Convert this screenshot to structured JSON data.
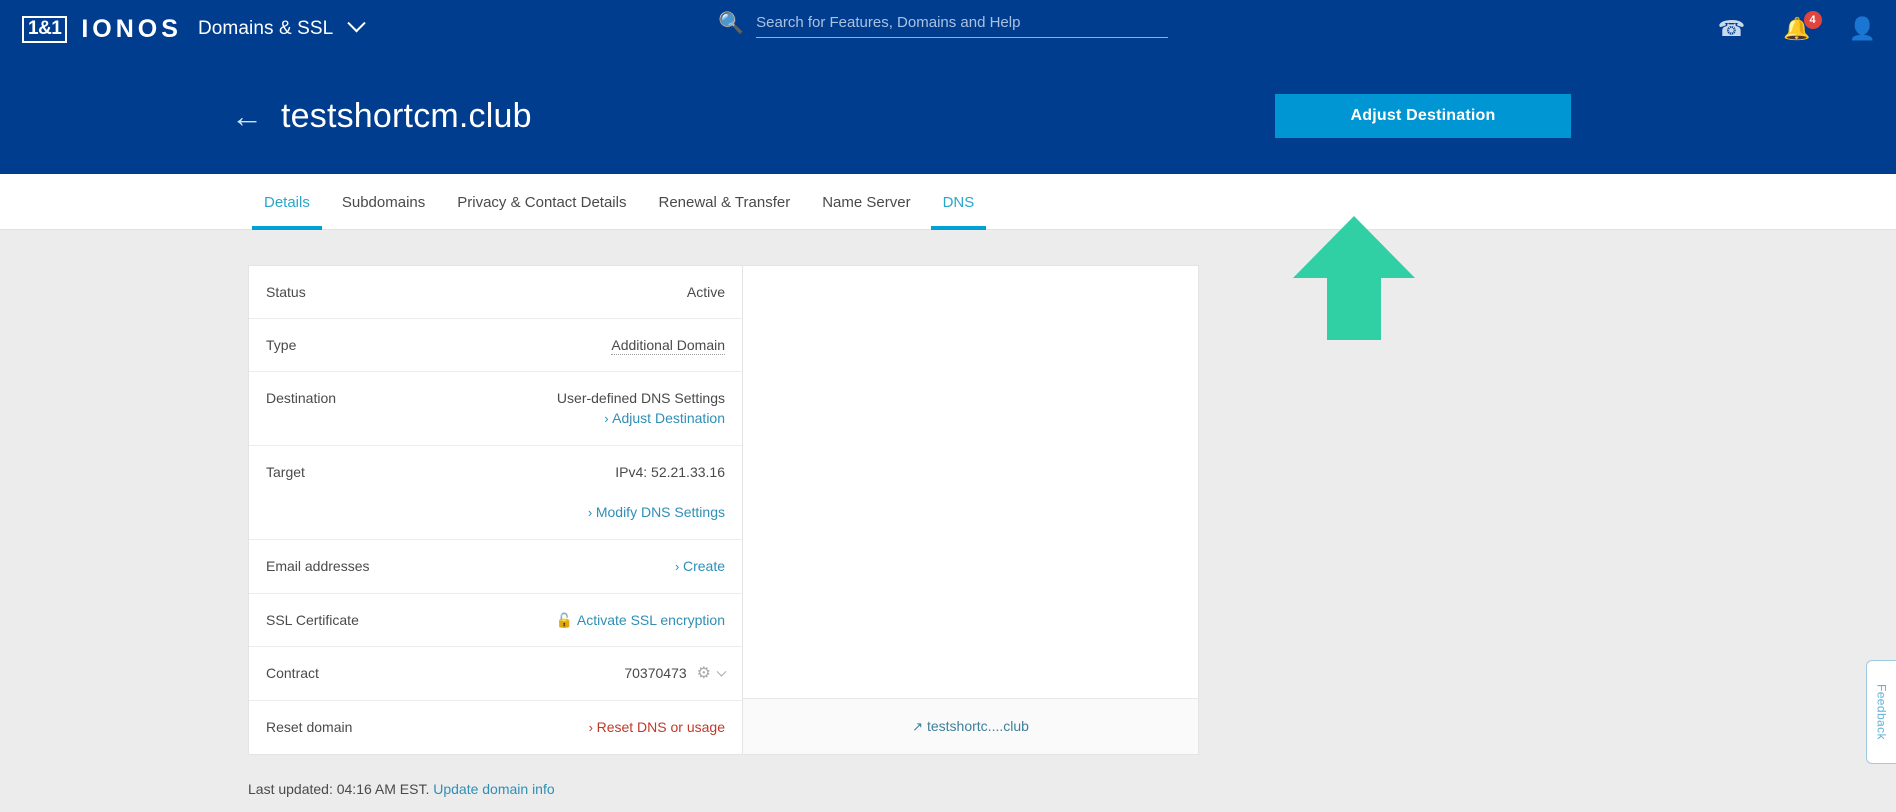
{
  "topnav": {
    "logo_badge": "1&1",
    "logo_word": "IONOS",
    "section": "Domains & SSL",
    "section_chevron_icon": "chevron-down-icon",
    "search": {
      "icon": "search-icon",
      "placeholder": "Search for Features, Domains and Help",
      "value": ""
    },
    "icons": {
      "phone": "✆",
      "bell": "🔔",
      "user": "👤"
    },
    "notification_count": "4"
  },
  "pagehead": {
    "back_icon": "←",
    "title": "testshortcm.club",
    "primary_button": "Adjust Destination"
  },
  "tabs": [
    {
      "label": "Details",
      "active": true
    },
    {
      "label": "Subdomains",
      "active": false
    },
    {
      "label": "Privacy & Contact Details",
      "active": false
    },
    {
      "label": "Renewal & Transfer",
      "active": false
    },
    {
      "label": "Name Server",
      "active": false
    },
    {
      "label": "DNS",
      "active": true
    }
  ],
  "details": [
    {
      "label": "Status",
      "value": "Active"
    },
    {
      "label": "Type",
      "value": "Additional Domain",
      "style": "dotted"
    },
    {
      "label": "Destination",
      "value": "User-defined DNS Settings",
      "action": "Adjust Destination"
    },
    {
      "label": "Target",
      "value": "IPv4: 52.21.33.16",
      "action": "Modify DNS Settings"
    },
    {
      "label": "Email addresses",
      "action": "Create"
    },
    {
      "label": "SSL Certificate",
      "action": "Activate SSL encryption",
      "icon": "open-lock-icon"
    },
    {
      "label": "Contract",
      "value": "70370473",
      "icon": "gear-icon"
    },
    {
      "label": "Reset domain",
      "action": "Reset DNS or usage",
      "action_style": "danger"
    }
  ],
  "preview": {
    "link_icon": "↗",
    "link_label": "testshortc....club"
  },
  "annotation": {
    "arrow_color": "#31cfa4",
    "points_to": "DNS"
  },
  "footer": {
    "last_updated": "Last updated: 04:16 AM EST.",
    "update_link": "Update domain info"
  },
  "feedback_tab": {
    "label": "Feedback"
  },
  "colors": {
    "header_blue": "#003d8f",
    "accent_cyan": "#0095d3",
    "tab_active": "#2aa6c9",
    "danger": "#c0392b",
    "badge_red": "#e2453e"
  }
}
